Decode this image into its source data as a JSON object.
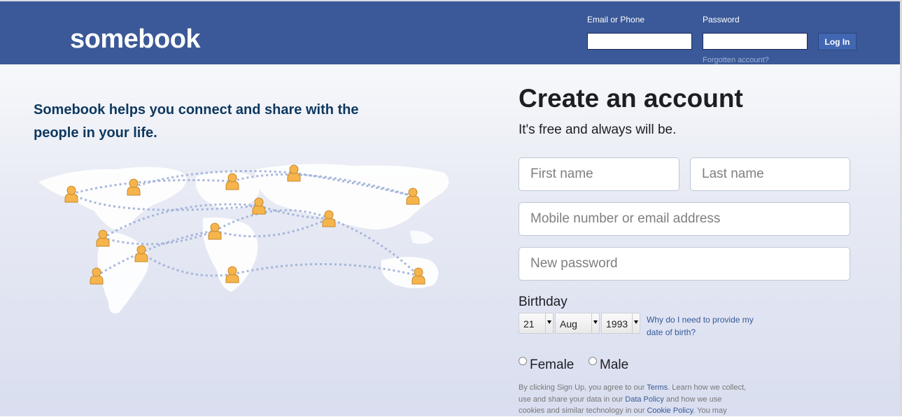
{
  "header": {
    "logo": "somebook",
    "email_label": "Email or Phone",
    "password_label": "Password",
    "login_button": "Log In",
    "forgot_link": "Forgotten account?"
  },
  "left": {
    "tagline": "Somebook helps you connect and share with the people in your life."
  },
  "signup": {
    "title": "Create an account",
    "subtitle": "It's free and always will be.",
    "first_name_placeholder": "First name",
    "last_name_placeholder": "Last name",
    "contact_placeholder": "Mobile number or email address",
    "password_placeholder": "New password",
    "birthday_label": "Birthday",
    "birthday_day": "21",
    "birthday_month": "Aug",
    "birthday_year": "1993",
    "birthday_help": "Why do I need to provide my date of birth?",
    "gender_female": "Female",
    "gender_male": "Male",
    "legal_prefix": "By clicking Sign Up, you agree to our ",
    "legal_terms": "Terms",
    "legal_mid1": ". Learn how we collect, use and share your data in our ",
    "legal_data_policy": "Data Policy",
    "legal_mid2": " and how we use cookies and similar technology in our ",
    "legal_cookie_policy": "Cookie Policy",
    "legal_suffix": ". You may"
  },
  "colors": {
    "brand": "#3b5998",
    "person_icon": "#f5b54c"
  }
}
